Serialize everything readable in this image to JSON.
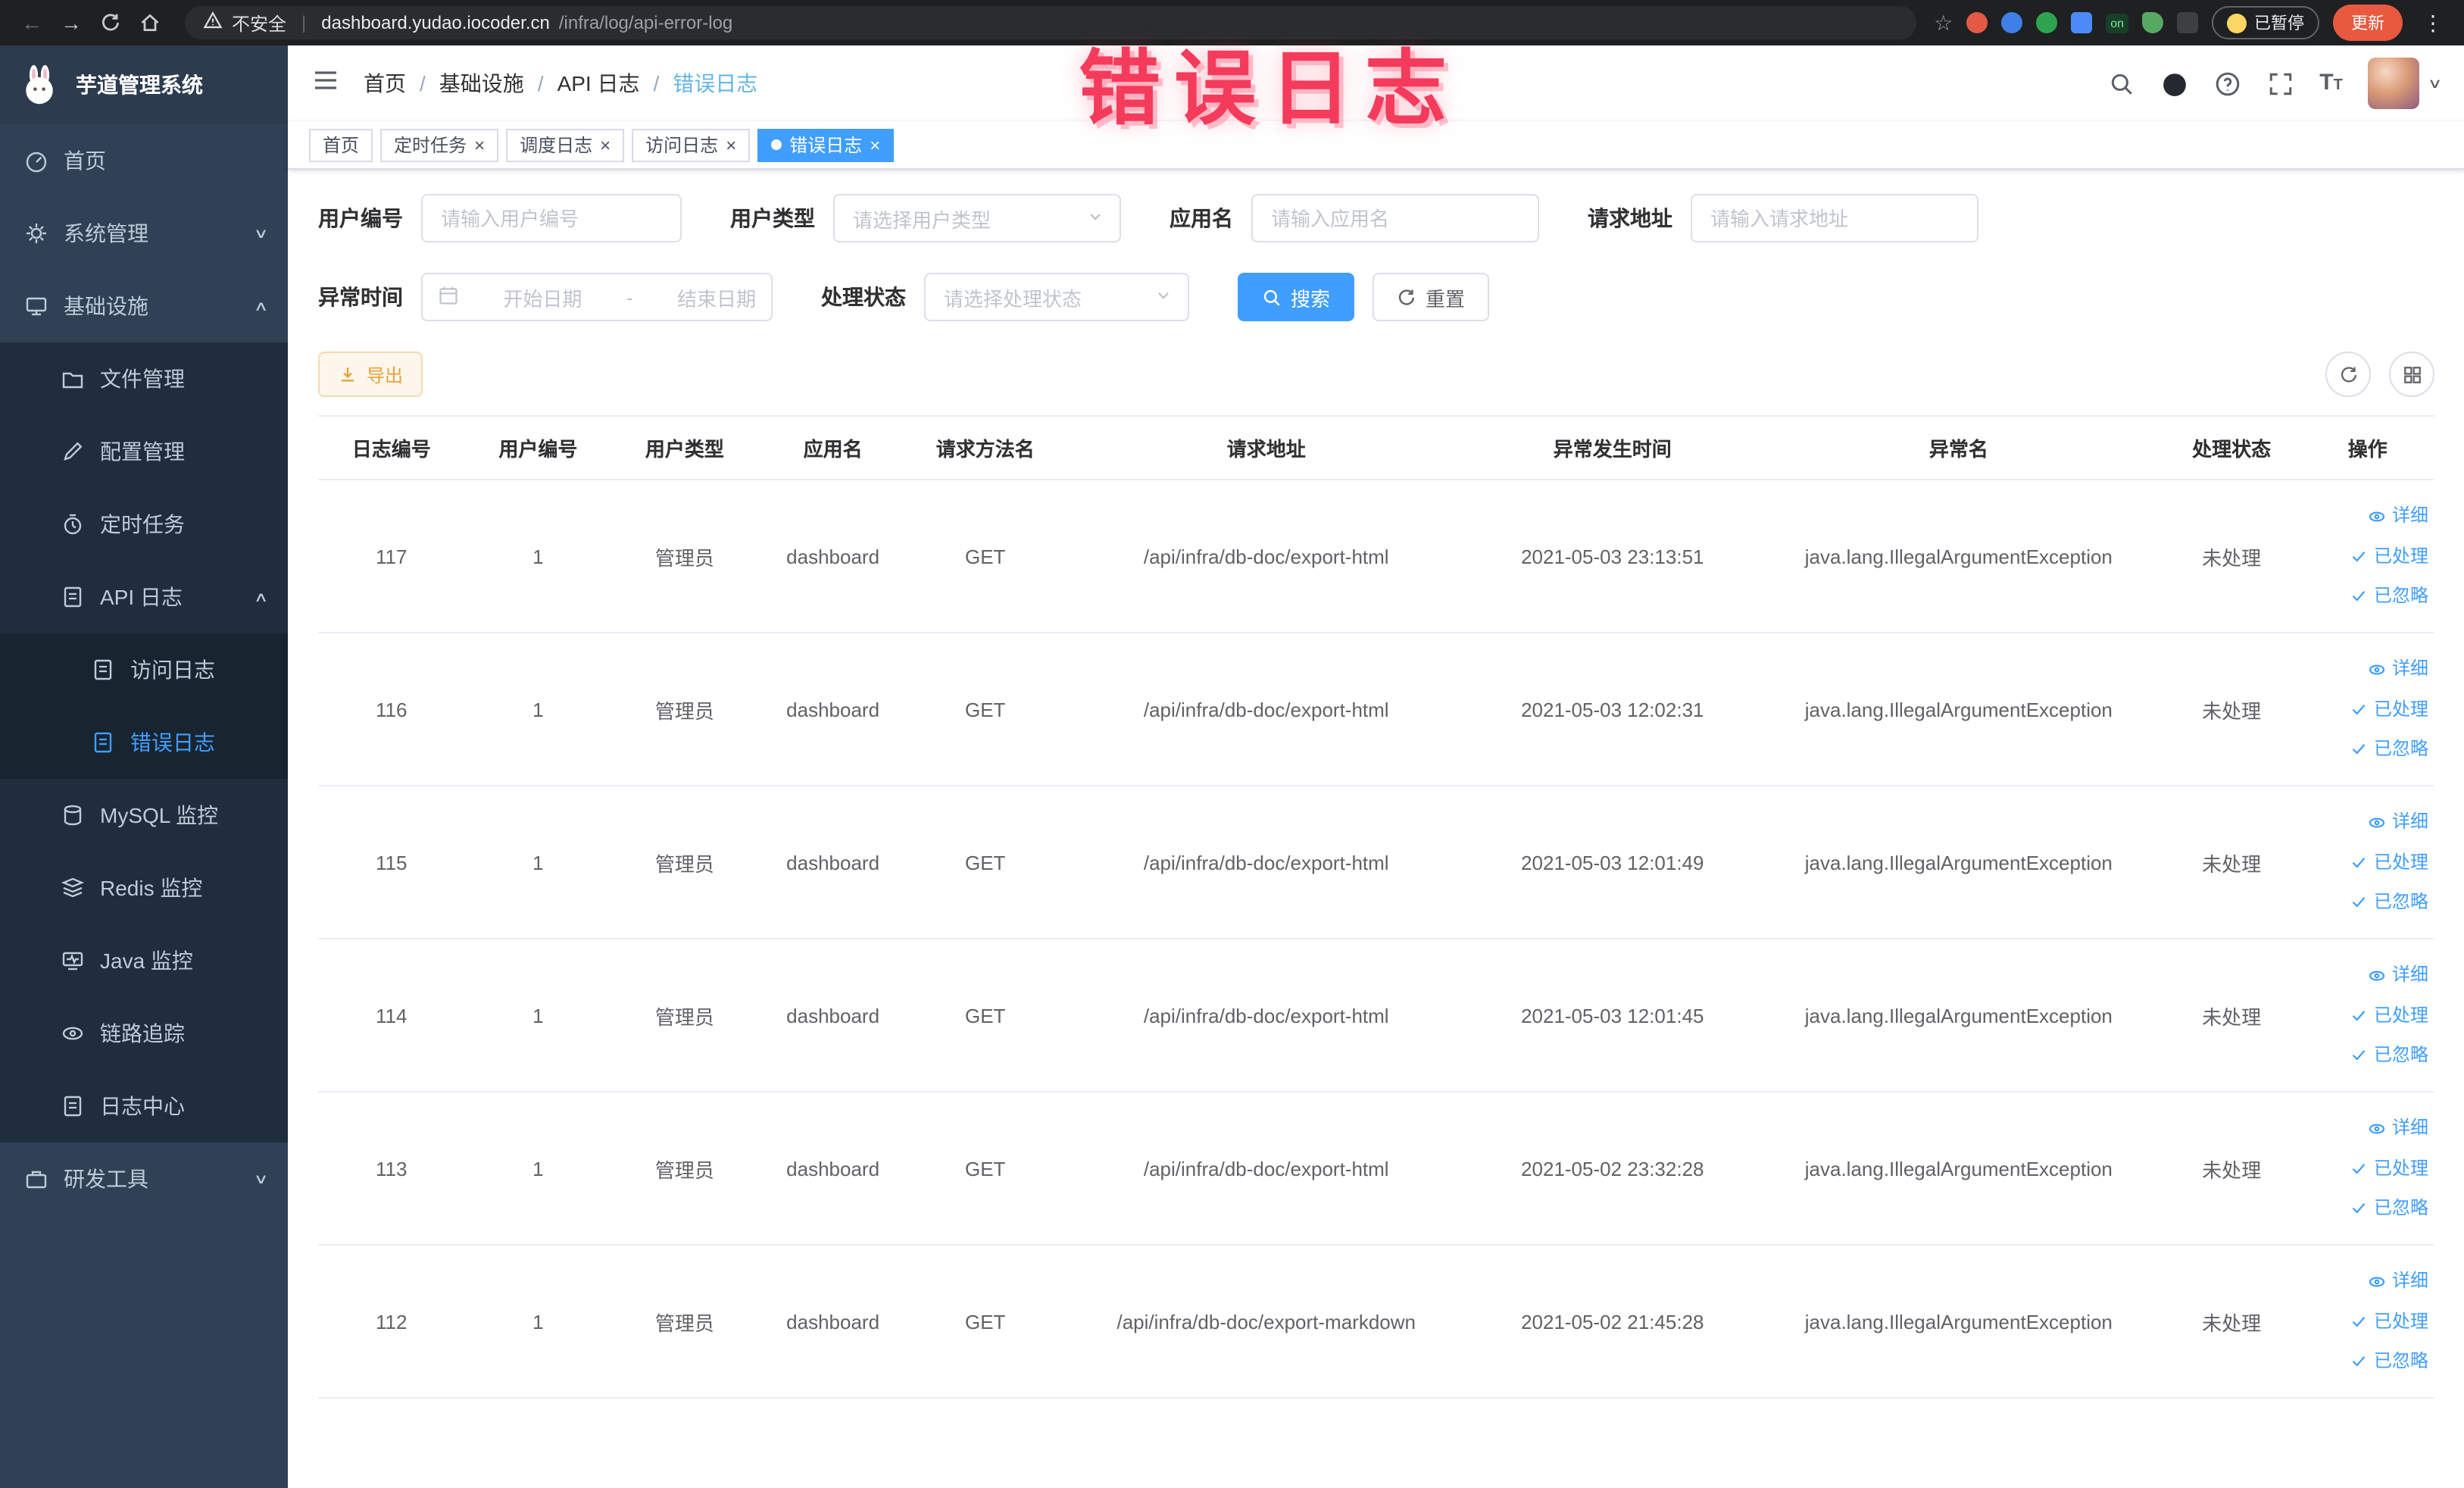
{
  "browser": {
    "security_label": "不安全",
    "url_host": "dashboard.yudao.iocoder.cn",
    "url_path": "/infra/log/api-error-log",
    "extension_badge_on": "on",
    "paused_badge": "已暂停",
    "update_button": "更新"
  },
  "annotation": {
    "text": "错误日志"
  },
  "sidebar": {
    "logo_title": "芋道管理系统",
    "items": [
      {
        "label": "首页"
      },
      {
        "label": "系统管理"
      },
      {
        "label": "基础设施"
      },
      {
        "label": "文件管理"
      },
      {
        "label": "配置管理"
      },
      {
        "label": "定时任务"
      },
      {
        "label": "API 日志"
      },
      {
        "label": "访问日志"
      },
      {
        "label": "错误日志"
      },
      {
        "label": "MySQL 监控"
      },
      {
        "label": "Redis 监控"
      },
      {
        "label": "Java 监控"
      },
      {
        "label": "链路追踪"
      },
      {
        "label": "日志中心"
      },
      {
        "label": "研发工具"
      }
    ]
  },
  "breadcrumb": {
    "separator": "/",
    "items": [
      "首页",
      "基础设施",
      "API 日志",
      "错误日志"
    ]
  },
  "tabs": [
    {
      "label": "首页"
    },
    {
      "label": "定时任务"
    },
    {
      "label": "调度日志"
    },
    {
      "label": "访问日志"
    },
    {
      "label": "错误日志"
    }
  ],
  "filters": {
    "user_id_label": "用户编号",
    "user_id_placeholder": "请输入用户编号",
    "user_type_label": "用户类型",
    "user_type_placeholder": "请选择用户类型",
    "app_name_label": "应用名",
    "app_name_placeholder": "请输入应用名",
    "request_url_label": "请求地址",
    "request_url_placeholder": "请输入请求地址",
    "exception_time_label": "异常时间",
    "date_start_placeholder": "开始日期",
    "date_separator": "-",
    "date_end_placeholder": "结束日期",
    "process_status_label": "处理状态",
    "process_status_placeholder": "请选择处理状态",
    "search_button": "搜索",
    "reset_button": "重置"
  },
  "toolbar": {
    "export_button": "导出"
  },
  "table": {
    "columns": [
      "日志编号",
      "用户编号",
      "用户类型",
      "应用名",
      "请求方法名",
      "请求地址",
      "异常发生时间",
      "异常名",
      "处理状态",
      "操作"
    ],
    "actions": {
      "detail": "详细",
      "processed": "已处理",
      "ignored": "已忽略"
    },
    "rows": [
      {
        "id": "117",
        "user_id": "1",
        "user_type": "管理员",
        "app": "dashboard",
        "method": "GET",
        "url": "/api/infra/db-doc/export-html",
        "time": "2021-05-03 23:13:51",
        "exception": "java.lang.IllegalArgumentException",
        "status": "未处理"
      },
      {
        "id": "116",
        "user_id": "1",
        "user_type": "管理员",
        "app": "dashboard",
        "method": "GET",
        "url": "/api/infra/db-doc/export-html",
        "time": "2021-05-03 12:02:31",
        "exception": "java.lang.IllegalArgumentException",
        "status": "未处理"
      },
      {
        "id": "115",
        "user_id": "1",
        "user_type": "管理员",
        "app": "dashboard",
        "method": "GET",
        "url": "/api/infra/db-doc/export-html",
        "time": "2021-05-03 12:01:49",
        "exception": "java.lang.IllegalArgumentException",
        "status": "未处理"
      },
      {
        "id": "114",
        "user_id": "1",
        "user_type": "管理员",
        "app": "dashboard",
        "method": "GET",
        "url": "/api/infra/db-doc/export-html",
        "time": "2021-05-03 12:01:45",
        "exception": "java.lang.IllegalArgumentException",
        "status": "未处理"
      },
      {
        "id": "113",
        "user_id": "1",
        "user_type": "管理员",
        "app": "dashboard",
        "method": "GET",
        "url": "/api/infra/db-doc/export-html",
        "time": "2021-05-02 23:32:28",
        "exception": "java.lang.IllegalArgumentException",
        "status": "未处理"
      },
      {
        "id": "112",
        "user_id": "1",
        "user_type": "管理员",
        "app": "dashboard",
        "method": "GET",
        "url": "/api/infra/db-doc/export-markdown",
        "time": "2021-05-02 21:45:28",
        "exception": "java.lang.IllegalArgumentException",
        "status": "未处理"
      }
    ]
  },
  "colors": {
    "accent": "#409eff",
    "warning": "#e6a23c",
    "sidebar_bg": "#304156",
    "sidebar_sub_bg": "#1f2d3d",
    "active_tag": "#409eff",
    "annotation": "#f43b5c",
    "update_button": "#e8593f"
  }
}
